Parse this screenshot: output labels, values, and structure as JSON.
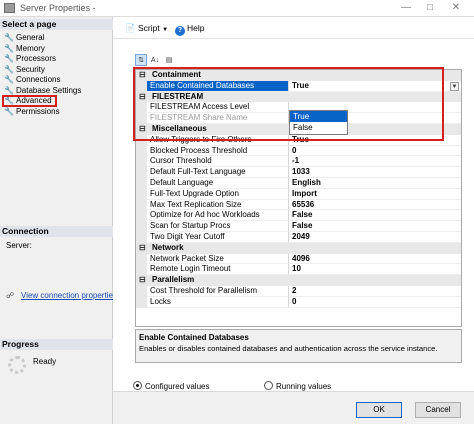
{
  "window": {
    "title": "Server Properties -",
    "minimize": "—",
    "maximize": "□",
    "close": "✕"
  },
  "left": {
    "select_page": "Select a page",
    "pages": [
      {
        "label": "General"
      },
      {
        "label": "Memory"
      },
      {
        "label": "Processors"
      },
      {
        "label": "Security"
      },
      {
        "label": "Connections"
      },
      {
        "label": "Database Settings"
      },
      {
        "label": "Advanced"
      },
      {
        "label": "Permissions"
      }
    ],
    "connection_header": "Connection",
    "server_label": "Server:",
    "view_connection": "View connection properties",
    "progress_header": "Progress",
    "progress_status": "Ready"
  },
  "toolbar": {
    "script": "Script",
    "help": "Help"
  },
  "grid": {
    "rows": [
      {
        "kind": "cat",
        "label": "Containment"
      },
      {
        "kind": "prop",
        "name": "Enable Contained Databases",
        "value": "True",
        "selected": true,
        "dropdown": true
      },
      {
        "kind": "cat",
        "label": "FILESTREAM"
      },
      {
        "kind": "prop",
        "name": "FILESTREAM Access Level",
        "value": ""
      },
      {
        "kind": "prop",
        "name": "FILESTREAM Share Name",
        "value": "",
        "disabled": true
      },
      {
        "kind": "cat",
        "label": "Miscellaneous"
      },
      {
        "kind": "prop",
        "name": "Allow Triggers to Fire Others",
        "value": "True"
      },
      {
        "kind": "prop",
        "name": "Blocked Process Threshold",
        "value": "0"
      },
      {
        "kind": "prop",
        "name": "Cursor Threshold",
        "value": "-1"
      },
      {
        "kind": "prop",
        "name": "Default Full-Text Language",
        "value": "1033"
      },
      {
        "kind": "prop",
        "name": "Default Language",
        "value": "English"
      },
      {
        "kind": "prop",
        "name": "Full-Text Upgrade Option",
        "value": "Import"
      },
      {
        "kind": "prop",
        "name": "Max Text Replication Size",
        "value": "65536"
      },
      {
        "kind": "prop",
        "name": "Optimize for Ad hoc Workloads",
        "value": "False"
      },
      {
        "kind": "prop",
        "name": "Scan for Startup Procs",
        "value": "False"
      },
      {
        "kind": "prop",
        "name": "Two Digit Year Cutoff",
        "value": "2049"
      },
      {
        "kind": "cat",
        "label": "Network"
      },
      {
        "kind": "prop",
        "name": "Network Packet Size",
        "value": "4096"
      },
      {
        "kind": "prop",
        "name": "Remote Login Timeout",
        "value": "10"
      },
      {
        "kind": "cat",
        "label": "Parallelism"
      },
      {
        "kind": "prop",
        "name": "Cost Threshold for Parallelism",
        "value": "2"
      },
      {
        "kind": "prop",
        "name": "Locks",
        "value": "0"
      }
    ],
    "dropdown_options": [
      "True",
      "False"
    ],
    "dropdown_selected": "True"
  },
  "description": {
    "title": "Enable Contained Databases",
    "text": "Enables or disables contained databases and authentication across the service instance."
  },
  "radios": {
    "configured": "Configured values",
    "running": "Running values",
    "selected": "configured"
  },
  "buttons": {
    "ok": "OK",
    "cancel": "Cancel"
  },
  "colors": {
    "selection": "#0a64c8",
    "highlight": "#d32020",
    "link": "#1a4bb5"
  }
}
